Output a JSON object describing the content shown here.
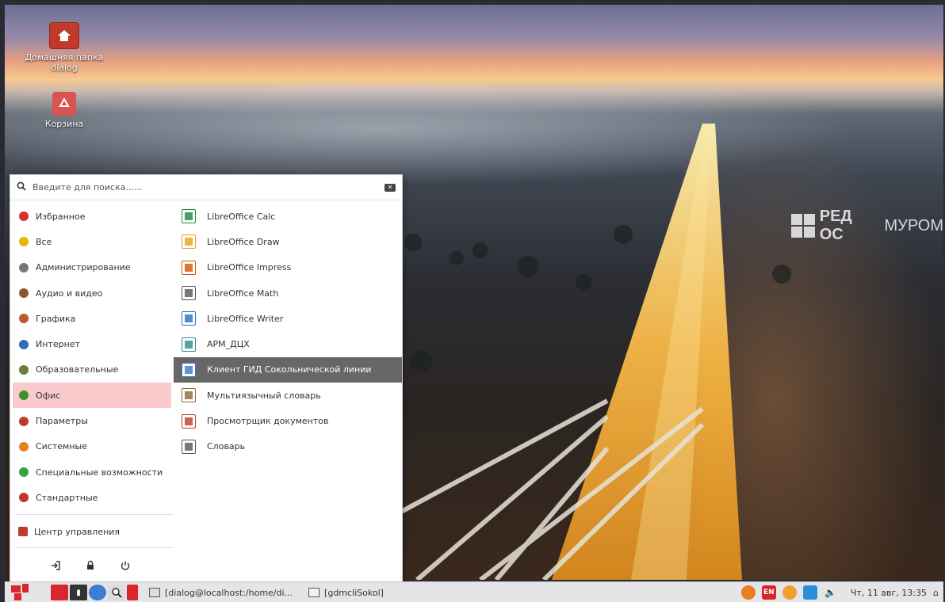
{
  "desktop": {
    "icons": [
      {
        "label_line1": "Домашняя папка",
        "label_line2": "dialog",
        "icon": "home-folder-icon"
      },
      {
        "label_line1": "Корзина",
        "icon": "trash-icon"
      }
    ],
    "brand_left": "РЕД ОС",
    "brand_right": "МУРОМ"
  },
  "menu": {
    "search": {
      "placeholder": "Введите для поиска......",
      "value": ""
    },
    "categories": [
      {
        "label": "Избранное",
        "icon": "heart-icon",
        "color": "#d9302c"
      },
      {
        "label": "Все",
        "icon": "star-icon",
        "color": "#e8b400"
      },
      {
        "label": "Администрирование",
        "icon": "tools-icon",
        "color": "#777777"
      },
      {
        "label": "Аудио и видео",
        "icon": "media-icon",
        "color": "#8a5a2a"
      },
      {
        "label": "Графика",
        "icon": "palette-icon",
        "color": "#c4572c"
      },
      {
        "label": "Интернет",
        "icon": "globe-icon",
        "color": "#2a6fb5"
      },
      {
        "label": "Образовательные",
        "icon": "education-icon",
        "color": "#6a7d3a"
      },
      {
        "label": "Офис",
        "icon": "office-icon",
        "color": "#3f8f2f",
        "active": true
      },
      {
        "label": "Параметры",
        "icon": "settings-icon",
        "color": "#c0392b"
      },
      {
        "label": "Системные",
        "icon": "system-icon",
        "color": "#e67e22"
      },
      {
        "label": "Специальные возможности",
        "icon": "accessibility-icon",
        "color": "#3aa04a"
      },
      {
        "label": "Стандартные",
        "icon": "accessories-icon",
        "color": "#c0392b"
      }
    ],
    "control_center": {
      "label": "Центр управления",
      "icon": "control-center-icon"
    },
    "apps": [
      {
        "label": "LibreOffice Calc",
        "icon": "calc-icon",
        "color": "#1e8a3a"
      },
      {
        "label": "LibreOffice Draw",
        "icon": "draw-icon",
        "color": "#e3a21a"
      },
      {
        "label": "LibreOffice Impress",
        "icon": "impress-icon",
        "color": "#d35400"
      },
      {
        "label": "LibreOffice Math",
        "icon": "math-icon",
        "color": "#555555"
      },
      {
        "label": "LibreOffice Writer",
        "icon": "writer-icon",
        "color": "#2a6fb5"
      },
      {
        "label": "АРМ_ДЦХ",
        "icon": "arm-dch-icon",
        "color": "#2d8a8a"
      },
      {
        "label": "Клиент ГИД Сокольнической линии",
        "icon": "gid-client-icon",
        "color": "#3a78c2",
        "highlighted": true
      },
      {
        "label": "Мультиязычный словарь",
        "icon": "multilingual-dictionary-icon",
        "color": "#8a6a3a"
      },
      {
        "label": "Просмотрщик документов",
        "icon": "document-viewer-icon",
        "color": "#c0392b"
      },
      {
        "label": "Словарь",
        "icon": "dictionary-icon",
        "color": "#555555"
      }
    ]
  },
  "taskbar": {
    "tasks": [
      {
        "label": "[dialog@localhost:/home/di...",
        "icon": "terminal-icon"
      },
      {
        "label": "[gdmcliSokol]",
        "icon": "folder-icon"
      }
    ],
    "tray": {
      "keyboard_layout": "EN",
      "clock": "Чт, 11 авг, 13:35"
    }
  }
}
